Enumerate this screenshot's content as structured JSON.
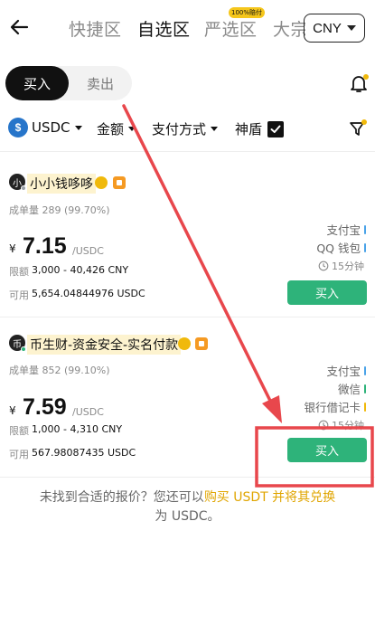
{
  "nav": {
    "tabs": [
      "快捷区",
      "自选区",
      "严选区",
      "大宗"
    ],
    "active_tab": "自选区",
    "strict_badge": "100%赔付",
    "currency": "CNY"
  },
  "toggle": {
    "buy": "买入",
    "sell": "卖出"
  },
  "filters": {
    "asset": "USDC",
    "amount": "金额",
    "payment": "支付方式",
    "shield": "神盾"
  },
  "ads": [
    {
      "merchant": "小小钱哆哆",
      "avatar": "小",
      "status_color": "#9aa0a6",
      "trades_label": "成单量",
      "trades": "289 (99.70%)",
      "currency_symbol": "¥",
      "price": "7.15",
      "unit": "/USDC",
      "limit_label": "限额",
      "limit": "3,000 - 40,426 CNY",
      "avail_label": "可用",
      "available": "5,654.04844976 USDC",
      "payments": [
        {
          "name": "支付宝",
          "color": "#4aa3e8"
        },
        {
          "name": "QQ 钱包",
          "color": "#4aa3e8"
        }
      ],
      "time": "15分钟",
      "button": "买入"
    },
    {
      "merchant": "币生财-资金安全-实名付款",
      "avatar": "币",
      "status_color": "#2eb37a",
      "trades_label": "成单量",
      "trades": "852 (99.10%)",
      "currency_symbol": "¥",
      "price": "7.59",
      "unit": "/USDC",
      "limit_label": "限额",
      "limit": "1,000 - 4,310 CNY",
      "avail_label": "可用",
      "available": "567.98087435 USDC",
      "payments": [
        {
          "name": "支付宝",
          "color": "#4aa3e8"
        },
        {
          "name": "微信",
          "color": "#2eb37a"
        },
        {
          "name": "银行借记卡",
          "color": "#f0b90b"
        }
      ],
      "time": "15分钟",
      "button": "买入"
    }
  ],
  "footer": {
    "prefix": "未找到合适的报价？您还可以",
    "link": "购买 USDT 并将其兑换",
    "suffix": "为 USDC。"
  },
  "colors": {
    "accent_green": "#2eb37a",
    "annotation_red": "#e8474c",
    "highlight_gold": "#e0a500"
  }
}
